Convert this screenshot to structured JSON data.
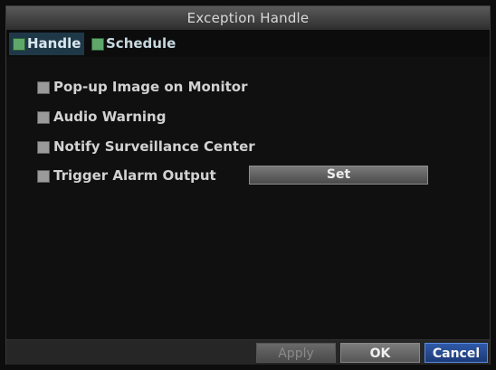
{
  "window": {
    "title": "Exception Handle"
  },
  "tabs": [
    {
      "label": "Handle",
      "active": true
    },
    {
      "label": "Schedule",
      "active": false
    }
  ],
  "options": [
    {
      "label": "Pop-up Image on Monitor",
      "checked": false
    },
    {
      "label": "Audio Warning",
      "checked": false
    },
    {
      "label": "Notify Surveillance Center",
      "checked": false
    },
    {
      "label": "Trigger Alarm Output",
      "checked": false
    }
  ],
  "alarm_output": {
    "set_label": "Set"
  },
  "footer": {
    "apply_label": "Apply",
    "ok_label": "OK",
    "cancel_label": "Cancel"
  },
  "colors": {
    "title_bar": "#3a3a3a",
    "active_tab": "#1f3848",
    "cancel_button": "#2a4f96"
  }
}
